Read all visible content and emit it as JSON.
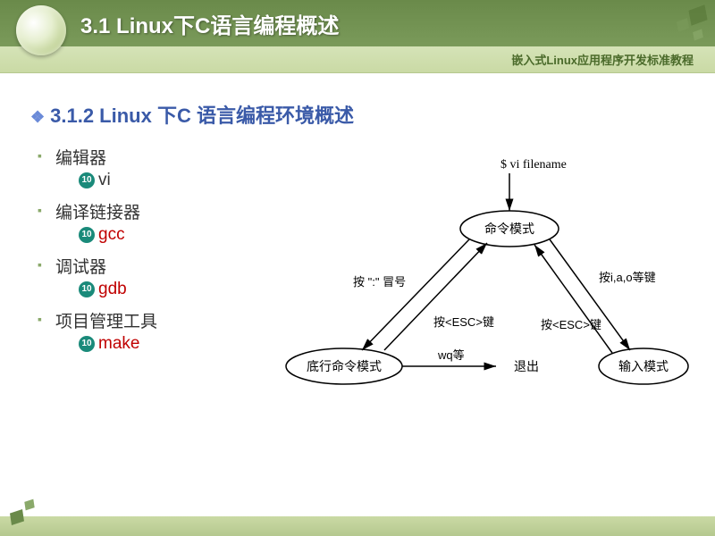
{
  "header": {
    "title": "3.1 Linux下C语言编程概述",
    "subtitle": "嵌入式Linux应用程序开发标准教程"
  },
  "section": {
    "heading": "3.1.2 Linux 下C 语言编程环境概述",
    "items": [
      {
        "label": "编辑器",
        "sub": "vi",
        "color": "black"
      },
      {
        "label": "编译链接器",
        "sub": "gcc",
        "color": "red"
      },
      {
        "label": "调试器",
        "sub": "gdb",
        "color": "red"
      },
      {
        "label": "项目管理工具",
        "sub": "make",
        "color": "red"
      }
    ]
  },
  "diagram": {
    "cmd_input": "$ vi filename",
    "nodes": {
      "command": "命令模式",
      "lastline": "底行命令模式",
      "insert": "输入模式",
      "exit": "退出"
    },
    "edges": {
      "to_lastline": "按 \":\" 冒号",
      "from_lastline": "按<ESC>键",
      "to_insert": "按i,a,o等键",
      "from_insert": "按<ESC>键",
      "lastline_exit": "wq等"
    }
  }
}
